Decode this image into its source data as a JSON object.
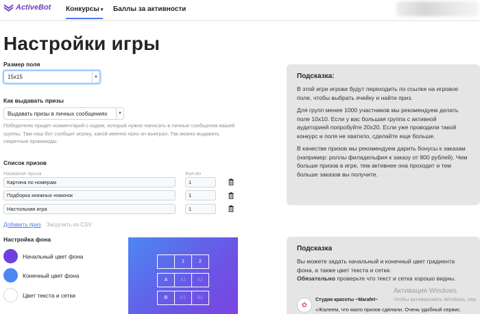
{
  "app": {
    "logo_text": "ActiveBot"
  },
  "nav": {
    "items": [
      {
        "label": "Конкурсы",
        "caret": "▾"
      },
      {
        "label": "Баллы за активности"
      }
    ]
  },
  "page": {
    "title": "Настройки игры"
  },
  "field_size": {
    "label": "Размер поля",
    "value": "15x15"
  },
  "prize_delivery": {
    "label": "Как выдавать призы",
    "value": "Выдавать призы в личных сообщениях",
    "help": "Победителю придет комментарий с кодом, который нужно написать в личные сообщения вашей группы. Там наш бот сообщит игроку, какой именно приз он выиграл. Так можно выдавать секретные промокоды."
  },
  "prizes": {
    "label": "Список призов",
    "col_name": "Название приза",
    "col_qty": "Кол-во",
    "items": [
      {
        "name": "Картина по номерам",
        "qty": "1"
      },
      {
        "name": "Подборка книжных новинок",
        "qty": "1"
      },
      {
        "name": "Настольная игра",
        "qty": "1"
      }
    ],
    "add_link": "Добавить приз",
    "csv_link": "Загрузить из CSV"
  },
  "background": {
    "label": "Настройка фона",
    "colors": [
      {
        "label": "Начальный цвет фона",
        "color": "#6f3fe0"
      },
      {
        "label": "Конечный цвет фона",
        "color": "#4b88f2"
      },
      {
        "label": "Цвет текста и сетки",
        "color": "#ffffff"
      }
    ]
  },
  "preview_grid": {
    "col_headers": [
      "1",
      "2"
    ],
    "rows": [
      {
        "header": "A",
        "cells": [
          "A1",
          "A2"
        ]
      },
      {
        "header": "B",
        "cells": [
          "B1",
          "B2"
        ]
      }
    ]
  },
  "hint1": {
    "title": "Подсказка:",
    "paragraphs": [
      "В этой игре игроки будут переходить по ссылке на игровое поле, чтобы выбрать ячейку и найти приз.",
      "Для групп менее 1000 участников мы рекомендуем делать поле 10x10. Если у вас большая группа с активной аудиторией попробуйте 20x20. Если уже проводили такой конкурс и поля не хватило, сделайте еще больше.",
      "В качестве призов мы рекомендуем дарить бонусы к заказам (например: роллы филадельфия к заказу от 800 рублей). Чем больше призов в игре, тем активнее она проходит и тем больше заказов вы получите."
    ]
  },
  "hint2": {
    "title": "Подсказка",
    "text": "Вы можете задать начальный и конечный цвет градиента фона, а также цвет текста и сетки.",
    "bold": "Обязательно",
    "bold_rest": " проверьте что текст и сетка хорошо видны."
  },
  "review": {
    "name": "Студия красоты ~Marafet~",
    "text": "«Жалеем, что мало призов сделали. Очень удобный сервис."
  },
  "watermark": {
    "line1": "Активация Windows",
    "line2": "Чтобы активировать Windows, пер"
  },
  "colors": {
    "accent": "#6f42c1",
    "link": "#4b78e6",
    "panel": "#e5e5e5"
  }
}
